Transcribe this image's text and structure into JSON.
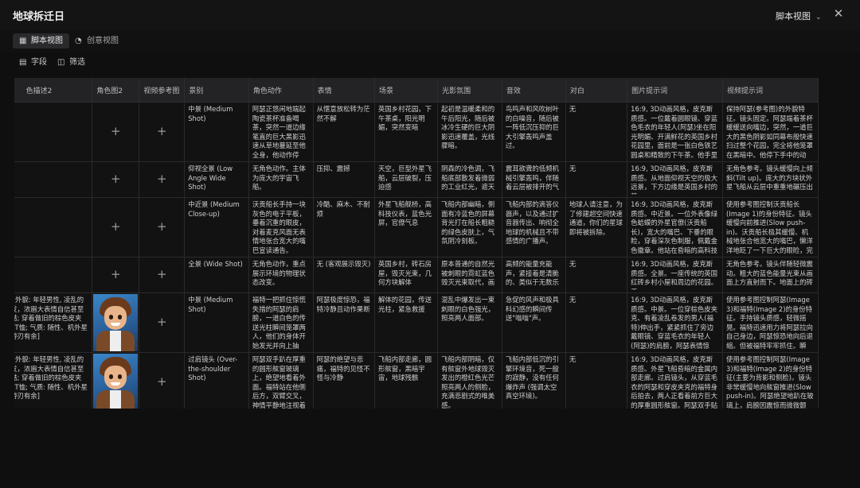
{
  "app": {
    "title": "地球拆迁日",
    "view_select": "脚本视图"
  },
  "view_tabs": [
    {
      "label": "脚本视图",
      "icon": "table-icon"
    },
    {
      "label": "创意视图",
      "icon": "palette-icon"
    }
  ],
  "toolbar": {
    "fields_label": "字段",
    "filter_label": "筛选"
  },
  "columns": [
    "色描述2",
    "角色图2",
    "视频参考图",
    "景别",
    "角色动作",
    "表情",
    "场景",
    "光影氛围",
    "音效",
    "对白",
    "图片提示词",
    "视频提示词"
  ],
  "rows": [
    {
      "desc2": "",
      "shot": "中景 (Medium Shot)",
      "action": "阿瑟正悠闲地端起陶瓷茶杯准备喝茶，突然一道边缘笔直的巨大黑影迅速从草地蔓延至他全身，他动作停",
      "expression": "从惬意放松转为茫然不解",
      "scene": "英国乡村花园，下午茶桌，阳光明媚，突然变暗",
      "lighting": "起初是温暖柔和的午后阳光，随后被冰冷生硬的巨大阴影迅速覆盖，光线骤暗。",
      "sound": "鸟鸣声和风吹树叶的白噪音，随后被一阵低沉压抑的巨大引擎轰鸣声盖过。",
      "dialogue": "无",
      "img_prompt": "16:9, 3D动画风格，皮克斯质感。一位戴着圆眼镜、穿蓝色毛衣的年轻人(阿瑟)坐在阳光明媚、开满鲜花的英国乡村花园里，面前是一张白色铁艺圆桌和精致的下午茶。他手里端着",
      "vid_prompt": "保持阿瑟(参考图)的外貌特征。镜头固定。阿瑟端着茶杯缓缓送向嘴边，突然，一道巨大的黑色阴影如同幕布般快速扫过整个花园，完全将他笼罩在黑暗中。他停下手中的动作，表"
    },
    {
      "desc2": "",
      "shot": "仰视全景 (Low Angle Wide Shot)",
      "action": "无角色动作。主体为庞大的宇宙飞船。",
      "expression": "压抑、震撼",
      "scene": "天空，巨型外星飞船，云层破裂，压迫感",
      "lighting": "阴森的冷色调，飞船底部散发着微弱的工业红光，遮天",
      "sound": "震耳欲聋的低频机械引擎轰鸣，伴随着云层被排开的气",
      "dialogue": "无",
      "img_prompt": "16:9, 3D动画风格，皮克斯质感。从地面仰视天空的极大远景，下方边缘是英国乡村的茅",
      "vid_prompt": "无角色参考。镜头缓慢向上倾斜(Tilt up)。庞大的方块状外星飞船从云层中重重地碾压出"
    },
    {
      "desc2": "",
      "shot": "中近景 (Medium Close-up)",
      "action": "沃贡船长手持一块灰色的电子平板，垂着沉重的眼皮，对着麦克风面无表情地张合宽大的嘴巴宣读通告。",
      "expression": "冷酷、麻木、不耐烦",
      "scene": "外星飞船舰桥，高科技仪表，蓝色光屏，官僚气息",
      "lighting": "飞船内部幽暗，侧面有冷蓝色的屏幕背光打在船长粗糙的绿色皮肤上，气氛阴冷刻板。",
      "sound": "飞船内部的滴答仪器声，以及通过扩音器传出、响彻全地球的机械且不带感情的广播声。",
      "dialogue": "地球人请注意，为了修建超空间快速通道，你们的星球即将被拆除。",
      "img_prompt": "16:9, 3D动画风格，皮克斯质感。中近景。一位外表像绿色蛤蟆的外星官僚(沃贡船长)，宽大的嘴巴、下垂的眼睑，穿着深灰色制服，佩戴金色徽章。他站在昏暗的高科技飞船舰桥",
      "vid_prompt": "使用参考图控制沃贡船长(Image 1)的身份特征。镜头缓慢向前推进(Slow push-in)。沃贡船长极其缓慢、机械地张合他宽大的嘴巴，懒洋洋地眨了一下巨大的眼睑，完全不带"
    },
    {
      "desc2": "",
      "shot": "全景 (Wide Shot)",
      "action": "无角色动作，重点展示环境的物理状态改变。",
      "expression": "无 (客观展示毁灭)",
      "scene": "英国乡村，砖石房屋，毁灭光束，几何方块解体",
      "lighting": "原本普通的自然光被刺眼的霓虹蓝色毁灭光束取代，画",
      "sound": "高频的能量充能声，紧接着是清脆的、类似于无数乐",
      "dialogue": "无",
      "img_prompt": "16:9, 3D动画风格，皮克斯质感。全景。一座传统的英国红砖乡村小屋和周边的花园。天",
      "vid_prompt": "无角色参考。镜头伴随轻微震动。粗大的蓝色能量光束从画面上方直射而下。地面上的砖"
    },
    {
      "desc2": "[; 福特; 外貌: 年轻男性, 凌乱的棕色卷发，浓眉大表情自信甚至带点狡黠; 穿着做旧的棕色皮夹克, 浅色T恤; 气质: 随性、机外星来客的游刃有余]",
      "shot": "中景 (Medium Shot)",
      "action": "福特一把抓住惊慌失措的阿瑟的肩膀，一道白色的传送光柱瞬间笼罩两人，他们的身体开始发光并向上抽",
      "expression": "阿瑟极度惊恐，福特冷静且动作果断",
      "scene": "解体的花园，传送光柱，紧急救援",
      "lighting": "混乱中爆发出一束刺眼的白色强光，照亮两人面部。",
      "sound": "急促的风声和极具科幻感的瞬间传送\"嗡嗡\"声。",
      "dialogue": "无",
      "img_prompt": "16:9, 3D动画风格，皮克斯质感。中景。一位穿棕色皮夹克、有着凌乱卷发的男人(福特)伸出手，紧紧抓住了旁边戴眼镜、穿蓝毛衣的年轻人(阿瑟)的肩膀，阿瑟表情惊恐。他们周",
      "vid_prompt": "使用参考图控制阿瑟(Image 3)和福特(Image 2)的身份特征。手持镜头质感，轻微摇晃。福特迅速用力将阿瑟拉向自己身边，阿瑟惊恐地向后退缩。但被福特牢牢抓住。瞬间，一道"
    },
    {
      "desc2": "[; 福特; 外貌: 年轻男性, 凌乱的棕色卷发，浓眉大表情自信甚至带点狡黠; 穿着做旧的棕色皮夹克, 浅色T恤; 气质: 随性、机外星来客的游刃有余]",
      "shot": "过肩镜头 (Over-the-shoulder Shot)",
      "action": "阿瑟双手趴在厚重的圆形舷窗玻璃上，绝望地看着外面。福特站在他侧后方，双臂交叉，神情平静地注视着",
      "expression": "阿瑟的绝望与悲痛，福特的见怪不怪与冷静",
      "scene": "飞船内部走廊，圆形舷窗，黑暗宇宙，地球残骸",
      "lighting": "飞船内部阴暗，仅有舷窗外地球毁灭发出的橙红色光芒照亮两人的侧脸，充满悲剧式的唯美感。",
      "sound": "飞船内部低沉的引擎环境音，死一般的寂静，没有任何爆炸声 (强调太空真空环境)。",
      "dialogue": "无",
      "img_prompt": "16:9, 3D动画风格，皮克斯质感。外星飞船昏暗的金属内部走廊。过肩镜头，从穿蓝毛衣的阿瑟和穿皮夹克的福特身后拍去，两人正看着前方巨大的厚重圆形舷窗。阿瑟双手贴",
      "vid_prompt": "使用参考图控制阿瑟(Image 3)和福特(Image 2)的身份特征(主要为背影和侧脸)。镜头非常缓慢地向舷窗推进(Slow push-in)。阿瑟绝望地趴在玻璃上，肩膀因震惊而微微颤"
    }
  ]
}
